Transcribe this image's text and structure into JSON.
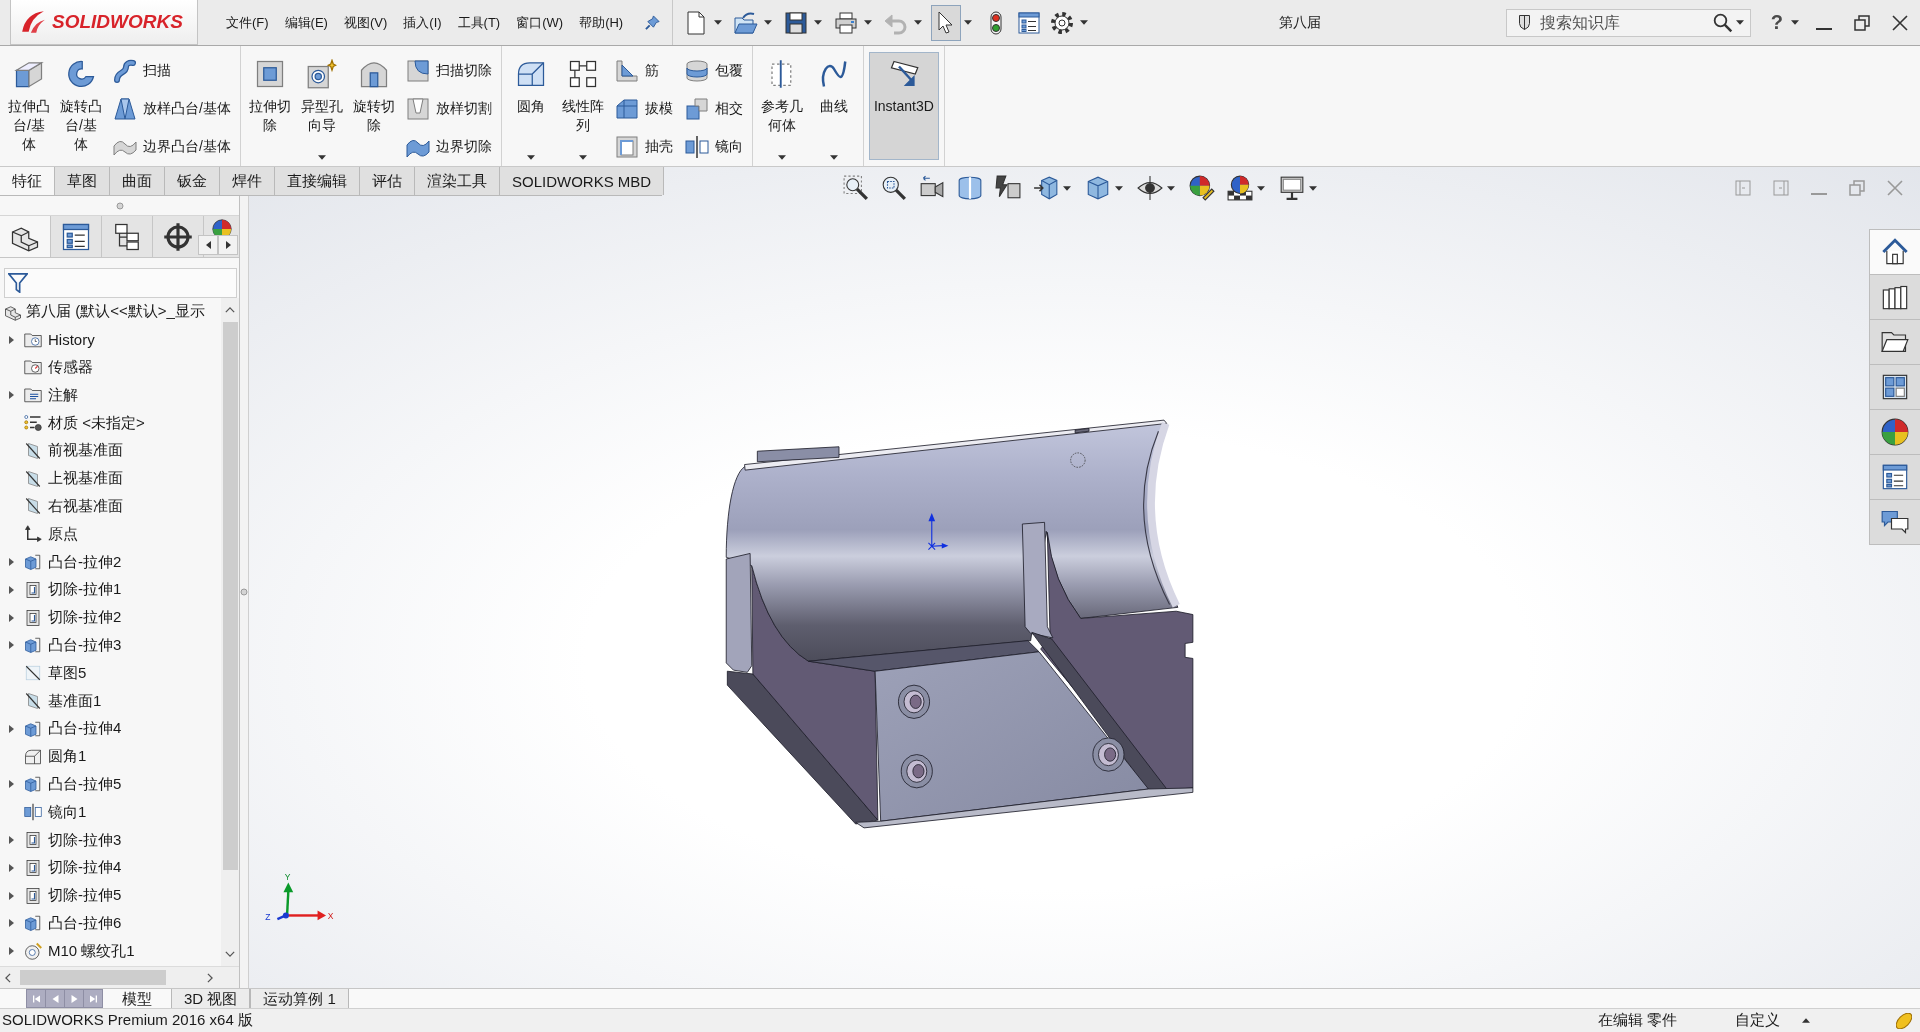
{
  "title_bar": {
    "logo_text": "SOLIDWORKS",
    "menu": [
      "文件(F)",
      "编辑(E)",
      "视图(V)",
      "插入(I)",
      "工具(T)",
      "窗口(W)",
      "帮助(H)"
    ],
    "quick_access": [
      {
        "kind": "new",
        "menu": true,
        "selected": false,
        "disabled": false
      },
      {
        "kind": "open",
        "menu": true,
        "selected": false,
        "disabled": false
      },
      {
        "kind": "save",
        "menu": true,
        "selected": false,
        "disabled": false
      },
      {
        "kind": "print",
        "menu": true,
        "selected": false,
        "disabled": false
      },
      {
        "kind": "undo",
        "menu": true,
        "selected": false,
        "disabled": true
      },
      {
        "kind": "select",
        "menu": true,
        "selected": true,
        "disabled": false
      },
      {
        "kind": "rebuild",
        "menu": false,
        "selected": false,
        "disabled": false
      },
      {
        "kind": "file-properties",
        "menu": false,
        "selected": false,
        "disabled": false
      },
      {
        "kind": "options",
        "menu": true,
        "selected": false,
        "disabled": false
      }
    ],
    "document_title": "第八届",
    "search": {
      "placeholder": "搜索知识库"
    },
    "help": "?"
  },
  "ribbon": {
    "groups": [
      {
        "buttons": [
          {
            "kind": "extrude-boss",
            "label": "拉伸凸台/基体",
            "dropdown": false,
            "on": false
          },
          {
            "kind": "revolve-boss",
            "label": "旋转凸台/基体",
            "dropdown": false,
            "on": false
          }
        ],
        "stacks": [
          [
            {
              "kind": "sweep",
              "label": "扫描"
            },
            {
              "kind": "loft",
              "label": "放样凸台/基体"
            },
            {
              "kind": "boundary",
              "label": "边界凸台/基体"
            }
          ]
        ]
      },
      {
        "buttons": [
          {
            "kind": "extrude-cut",
            "label": "拉伸切除",
            "dropdown": false,
            "on": false
          },
          {
            "kind": "hole-wizard",
            "label": "异型孔向导",
            "dropdown": true,
            "on": false
          },
          {
            "kind": "revolve-cut",
            "label": "旋转切除",
            "dropdown": false,
            "on": false
          }
        ],
        "stacks": [
          [
            {
              "kind": "sweep-cut",
              "label": "扫描切除"
            },
            {
              "kind": "loft-cut",
              "label": "放样切割"
            },
            {
              "kind": "boundary-cut",
              "label": "边界切除"
            }
          ]
        ]
      },
      {
        "buttons": [
          {
            "kind": "fillet",
            "label": "圆角",
            "dropdown": true,
            "on": false
          },
          {
            "kind": "linear-pattern",
            "label": "线性阵列",
            "dropdown": true,
            "on": false
          }
        ],
        "stacks": [
          [
            {
              "kind": "rib",
              "label": "筋"
            },
            {
              "kind": "draft",
              "label": "拔模"
            },
            {
              "kind": "shell",
              "label": "抽壳"
            }
          ],
          [
            {
              "kind": "wrap",
              "label": "包覆"
            },
            {
              "kind": "intersect",
              "label": "相交"
            },
            {
              "kind": "mirror",
              "label": "镜向"
            }
          ]
        ]
      },
      {
        "buttons": [
          {
            "kind": "reference-geometry",
            "label": "参考几何体",
            "dropdown": true,
            "on": false
          },
          {
            "kind": "curves",
            "label": "曲线",
            "dropdown": true,
            "on": false
          }
        ]
      },
      {
        "buttons": [
          {
            "kind": "instant3d",
            "label": "Instant3D",
            "dropdown": false,
            "on": true
          }
        ]
      }
    ]
  },
  "command_tabs": [
    {
      "label": "特征",
      "selected": true
    },
    {
      "label": "草图",
      "selected": false
    },
    {
      "label": "曲面",
      "selected": false
    },
    {
      "label": "钣金",
      "selected": false
    },
    {
      "label": "焊件",
      "selected": false
    },
    {
      "label": "直接编辑",
      "selected": false
    },
    {
      "label": "评估",
      "selected": false
    },
    {
      "label": "渲染工具",
      "selected": false
    },
    {
      "label": "SOLIDWORKS MBD",
      "selected": false
    }
  ],
  "feature_manager": {
    "tabs": [
      {
        "kind": "feature-tree",
        "selected": true
      },
      {
        "kind": "property",
        "selected": false
      },
      {
        "kind": "configuration",
        "selected": false
      },
      {
        "kind": "dimxpert",
        "selected": false
      },
      {
        "kind": "display",
        "selected": false
      }
    ],
    "root": {
      "kind": "part",
      "label": "第八届 (默认<<默认>_显示"
    },
    "items": [
      {
        "kind": "history",
        "label": "History",
        "expanded": false
      },
      {
        "kind": "sensors",
        "label": "传感器"
      },
      {
        "kind": "annotations",
        "label": "注解",
        "expanded": false
      },
      {
        "kind": "material",
        "label": "材质 <未指定>"
      },
      {
        "kind": "plane",
        "label": "前视基准面"
      },
      {
        "kind": "plane",
        "label": "上视基准面"
      },
      {
        "kind": "plane",
        "label": "右视基准面"
      },
      {
        "kind": "origin",
        "label": "原点"
      },
      {
        "kind": "boss",
        "label": "凸台-拉伸2",
        "expanded": false
      },
      {
        "kind": "cut",
        "label": "切除-拉伸1",
        "expanded": false
      },
      {
        "kind": "cut",
        "label": "切除-拉伸2",
        "expanded": false
      },
      {
        "kind": "boss",
        "label": "凸台-拉伸3",
        "expanded": false
      },
      {
        "kind": "sketch",
        "label": "草图5"
      },
      {
        "kind": "plane",
        "label": "基准面1"
      },
      {
        "kind": "boss",
        "label": "凸台-拉伸4",
        "expanded": false
      },
      {
        "kind": "fillet",
        "label": "圆角1"
      },
      {
        "kind": "boss",
        "label": "凸台-拉伸5",
        "expanded": false
      },
      {
        "kind": "mirror",
        "label": "镜向1"
      },
      {
        "kind": "cut",
        "label": "切除-拉伸3",
        "expanded": false
      },
      {
        "kind": "cut",
        "label": "切除-拉伸4",
        "expanded": false
      },
      {
        "kind": "cut",
        "label": "切除-拉伸5",
        "expanded": false
      },
      {
        "kind": "boss",
        "label": "凸台-拉伸6",
        "expanded": false
      },
      {
        "kind": "hole",
        "label": "M10 螺纹孔1",
        "expanded": false
      }
    ]
  },
  "viewport": {
    "axis_labels": {
      "y": "Y",
      "x": "X",
      "z": "Z"
    }
  },
  "task_pane": [
    {
      "kind": "home",
      "selected": true
    },
    {
      "kind": "design-library",
      "selected": false
    },
    {
      "kind": "file-explorer",
      "selected": false
    },
    {
      "kind": "view-palette",
      "selected": false
    },
    {
      "kind": "appearances",
      "selected": false
    },
    {
      "kind": "custom-properties",
      "selected": false
    },
    {
      "kind": "forum",
      "selected": false
    }
  ],
  "bottom_tabs": [
    {
      "label": "模型",
      "selected": true
    },
    {
      "label": "3D 视图",
      "selected": false
    },
    {
      "label": "运动算例 1",
      "selected": false
    }
  ],
  "status_bar": {
    "product": "SOLIDWORKS Premium 2016 x64 版",
    "mode": "在编辑 零件",
    "units": "自定义"
  }
}
